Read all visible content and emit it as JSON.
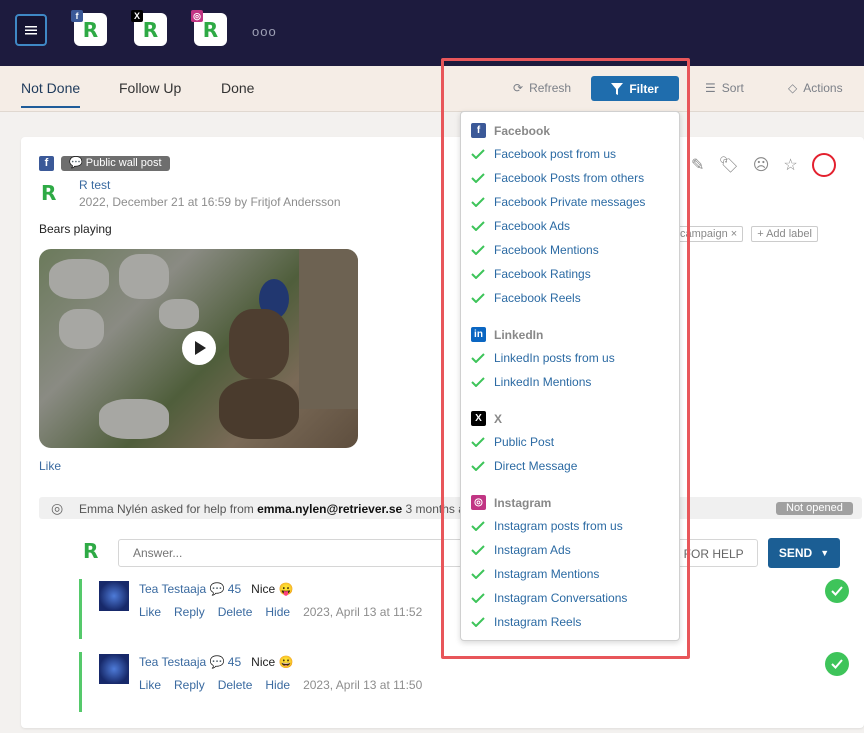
{
  "nav": {
    "channels": [
      {
        "name": "facebook",
        "badge": "f"
      },
      {
        "name": "x",
        "badge": "X"
      },
      {
        "name": "instagram",
        "badge": "◎"
      }
    ],
    "more": "ooo"
  },
  "tabs": [
    "Not Done",
    "Follow Up",
    "Done"
  ],
  "toolbar": {
    "refresh": "Refresh",
    "filter": "Filter",
    "sort": "Sort",
    "actions": "Actions"
  },
  "post": {
    "type_tag": "Public wall post",
    "author": "R test",
    "meta": "2022, December 21 at 16:59 by Fritjof Andersson",
    "text": "Bears playing",
    "like": "Like",
    "label": "campaign",
    "add_label": "Add label"
  },
  "help": {
    "prefix": "Emma Nylén asked for help from ",
    "email": "emma.nylen@retriever.se",
    "suffix": " 3 months ag",
    "status": "Not opened"
  },
  "reply": {
    "placeholder": "Answer...",
    "ask_help": "K FOR HELP",
    "send": "SEND"
  },
  "comments": [
    {
      "name": "Tea Testaaja",
      "count": "45",
      "text": "Nice 😛",
      "date": "2023, April 13 at 11:52"
    },
    {
      "name": "Tea Testaaja",
      "count": "45",
      "text": "Nice 😀",
      "date": "2023, April 13 at 11:50"
    }
  ],
  "comment_actions": [
    "Like",
    "Reply",
    "Delete",
    "Hide"
  ],
  "filter_menu": {
    "groups": [
      {
        "name": "Facebook",
        "icon": "f",
        "color": "#3b5998",
        "options": [
          "Facebook post from us",
          "Facebook Posts from others",
          "Facebook Private messages",
          "Facebook Ads",
          "Facebook Mentions",
          "Facebook Ratings",
          "Facebook Reels"
        ]
      },
      {
        "name": "LinkedIn",
        "icon": "in",
        "color": "#0a66c2",
        "options": [
          "LinkedIn posts from us",
          "LinkedIn Mentions"
        ]
      },
      {
        "name": "X",
        "icon": "X",
        "color": "#000000",
        "options": [
          "Public Post",
          "Direct Message"
        ]
      },
      {
        "name": "Instagram",
        "icon": "◎",
        "color": "#c13584",
        "options": [
          "Instagram posts from us",
          "Instagram Ads",
          "Instagram Mentions",
          "Instagram Conversations",
          "Instagram Reels"
        ]
      }
    ]
  },
  "colors": {
    "topbar": "#1d1b3e",
    "accent": "#1f6dad",
    "check": "#3ec45a",
    "highlight": "#e8565a"
  }
}
